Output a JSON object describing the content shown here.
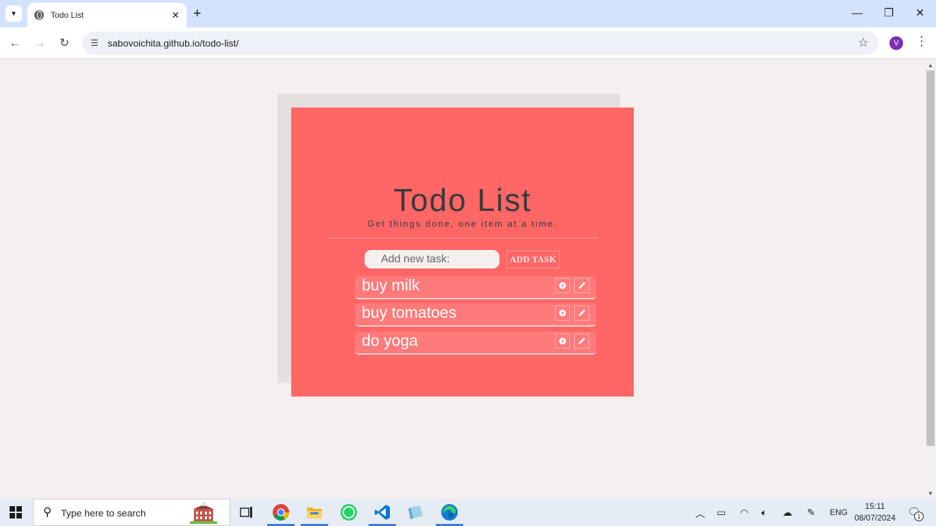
{
  "browser": {
    "tab_title": "Todo List",
    "url": "sabovoichita.github.io/todo-list/",
    "profile_initial": "V"
  },
  "app": {
    "title": "Todo List",
    "subtitle": "Get things done, one item at a time.",
    "input_placeholder": "Add new task:",
    "add_button_label": "ADD TASK",
    "tasks": [
      {
        "label": "buy milk"
      },
      {
        "label": "buy tomatoes"
      },
      {
        "label": "do yoga"
      }
    ],
    "colors": {
      "card": "#ff6666",
      "task": "#ff7a7a",
      "page_bg": "#f5efef"
    }
  },
  "taskbar": {
    "search_placeholder": "Type here to search",
    "language": "ENG",
    "time": "15:11",
    "date": "08/07/2024",
    "notification_count": "1"
  }
}
